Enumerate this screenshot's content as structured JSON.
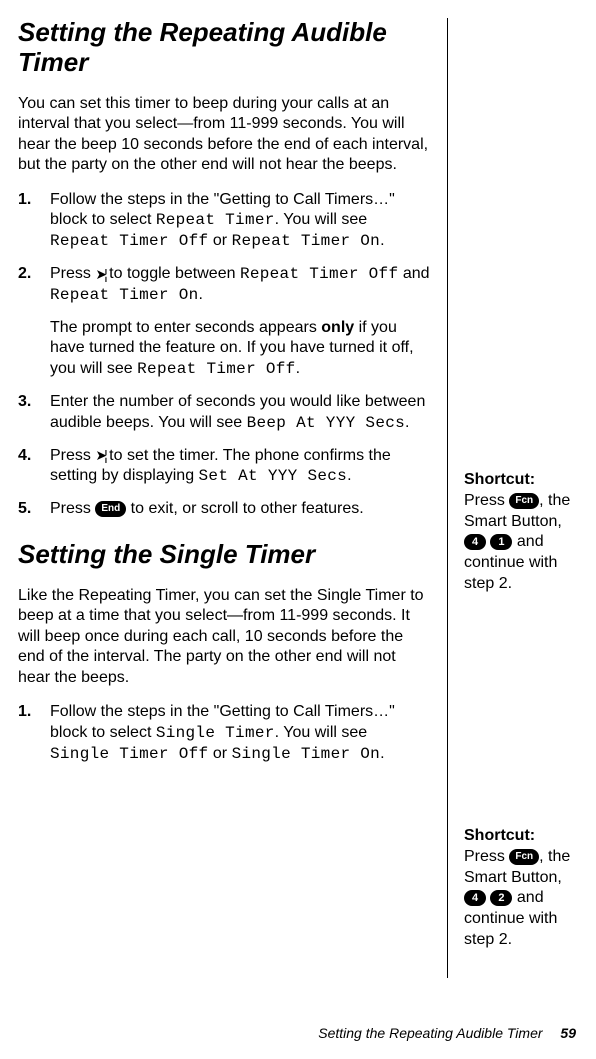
{
  "section1": {
    "title": "Setting the Repeating Audible Timer",
    "intro": "You can set this timer to beep during your calls at an interval that you select—from 11-999 seconds. You will hear the beep 10 seconds before the end of each interval, but the party on the other end will not hear the beeps.",
    "steps": {
      "s1": {
        "num": "1.",
        "t1": "Follow the steps in the \"Getting to Call Timers…\" block to select ",
        "lcd1": "Repeat Timer",
        "t2": ". You will see ",
        "lcd2": "Repeat Timer Off",
        "t3": " or ",
        "lcd3": "Repeat Timer On",
        "t4": "."
      },
      "s2": {
        "num": "2.",
        "t1": "Press ",
        "t2": " to toggle between ",
        "lcd1": "Repeat Timer Off",
        "t3": " and ",
        "lcd2": "Repeat Timer On",
        "t4": ".",
        "sub_t1": "The prompt to enter seconds appears ",
        "sub_bold": "only",
        "sub_t2": " if you have turned the feature on. If you have turned it off, you will see ",
        "sub_lcd": "Repeat Timer Off",
        "sub_t3": "."
      },
      "s3": {
        "num": "3.",
        "t1": "Enter the number of seconds you would like between audible beeps. You will see ",
        "lcd1": "Beep At YYY Secs",
        "t2": "."
      },
      "s4": {
        "num": "4.",
        "t1": "Press ",
        "t2": " to set the timer. The phone confirms the setting by displaying ",
        "lcd1": "Set At YYY Secs",
        "t3": "."
      },
      "s5": {
        "num": "5.",
        "t1": "Press ",
        "t2": " to exit, or scroll to other features."
      }
    }
  },
  "section2": {
    "title": "Setting the Single Timer",
    "intro": "Like the Repeating Timer, you can set the Single Timer to beep at a time that you select—from 11-999 seconds. It will beep once during each call, 10 seconds before the end of the interval. The party on the other end will not hear the beeps.",
    "steps": {
      "s1": {
        "num": "1.",
        "t1": "Follow the steps in the \"Getting to Call Timers…\" block to select ",
        "lcd1": "Single Timer",
        "t2": ". You will see ",
        "lcd2": "Single Timer Off",
        "t3": " or ",
        "lcd3": "Single Timer On",
        "t4": "."
      }
    }
  },
  "keys": {
    "fcn": "Fcn",
    "end": "End",
    "k4": "4",
    "k1": "1",
    "k2": "2"
  },
  "shortcut1": {
    "label": "Shortcut:",
    "t1": "Press ",
    "t2": ", the Smart Button, ",
    "t3": " ",
    "t4": " and continue with step 2."
  },
  "shortcut2": {
    "label": "Shortcut:",
    "t1": "Press ",
    "t2": ", the Smart Button, ",
    "t3": " ",
    "t4": " and continue with step 2."
  },
  "footer": {
    "text": "Setting the Repeating Audible Timer",
    "page": "59"
  }
}
